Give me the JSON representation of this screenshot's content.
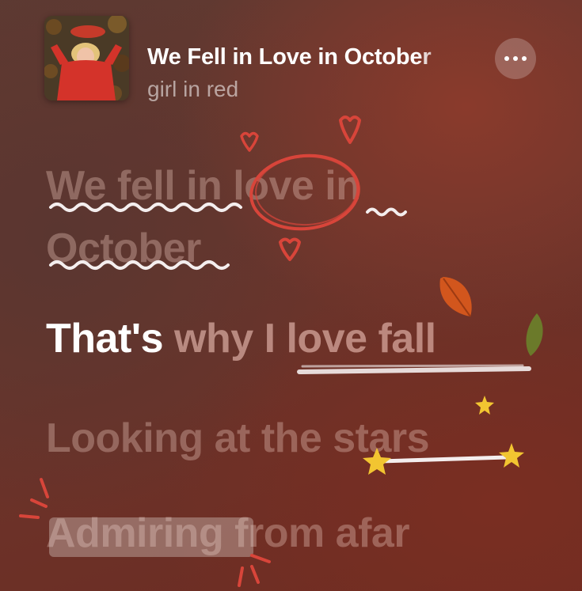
{
  "now_playing": {
    "title": "We Fell in Love in October",
    "artist": "girl in red",
    "album_art": "album-cover-image",
    "more_icon": "ellipsis-icon"
  },
  "lyrics": {
    "line1_part1": "We fell in",
    "line1_part2": "love",
    "line1_part3": "in",
    "line2": "October",
    "line3_sung": "That's",
    "line3_unsung": "why I love fall",
    "line4": "Looking at the stars",
    "line5_part1": "Admiring",
    "line5_part2": "from afar"
  },
  "colors": {
    "background_top": "#5d3a32",
    "background_bottom": "#6e2b21",
    "active_lyric": "#ffffff",
    "doodle_red": "#d8453a",
    "doodle_yellow": "#f2c531",
    "doodle_white": "#f4eeee",
    "leaf_orange": "#d2561d",
    "leaf_green": "#6b7a2a"
  }
}
